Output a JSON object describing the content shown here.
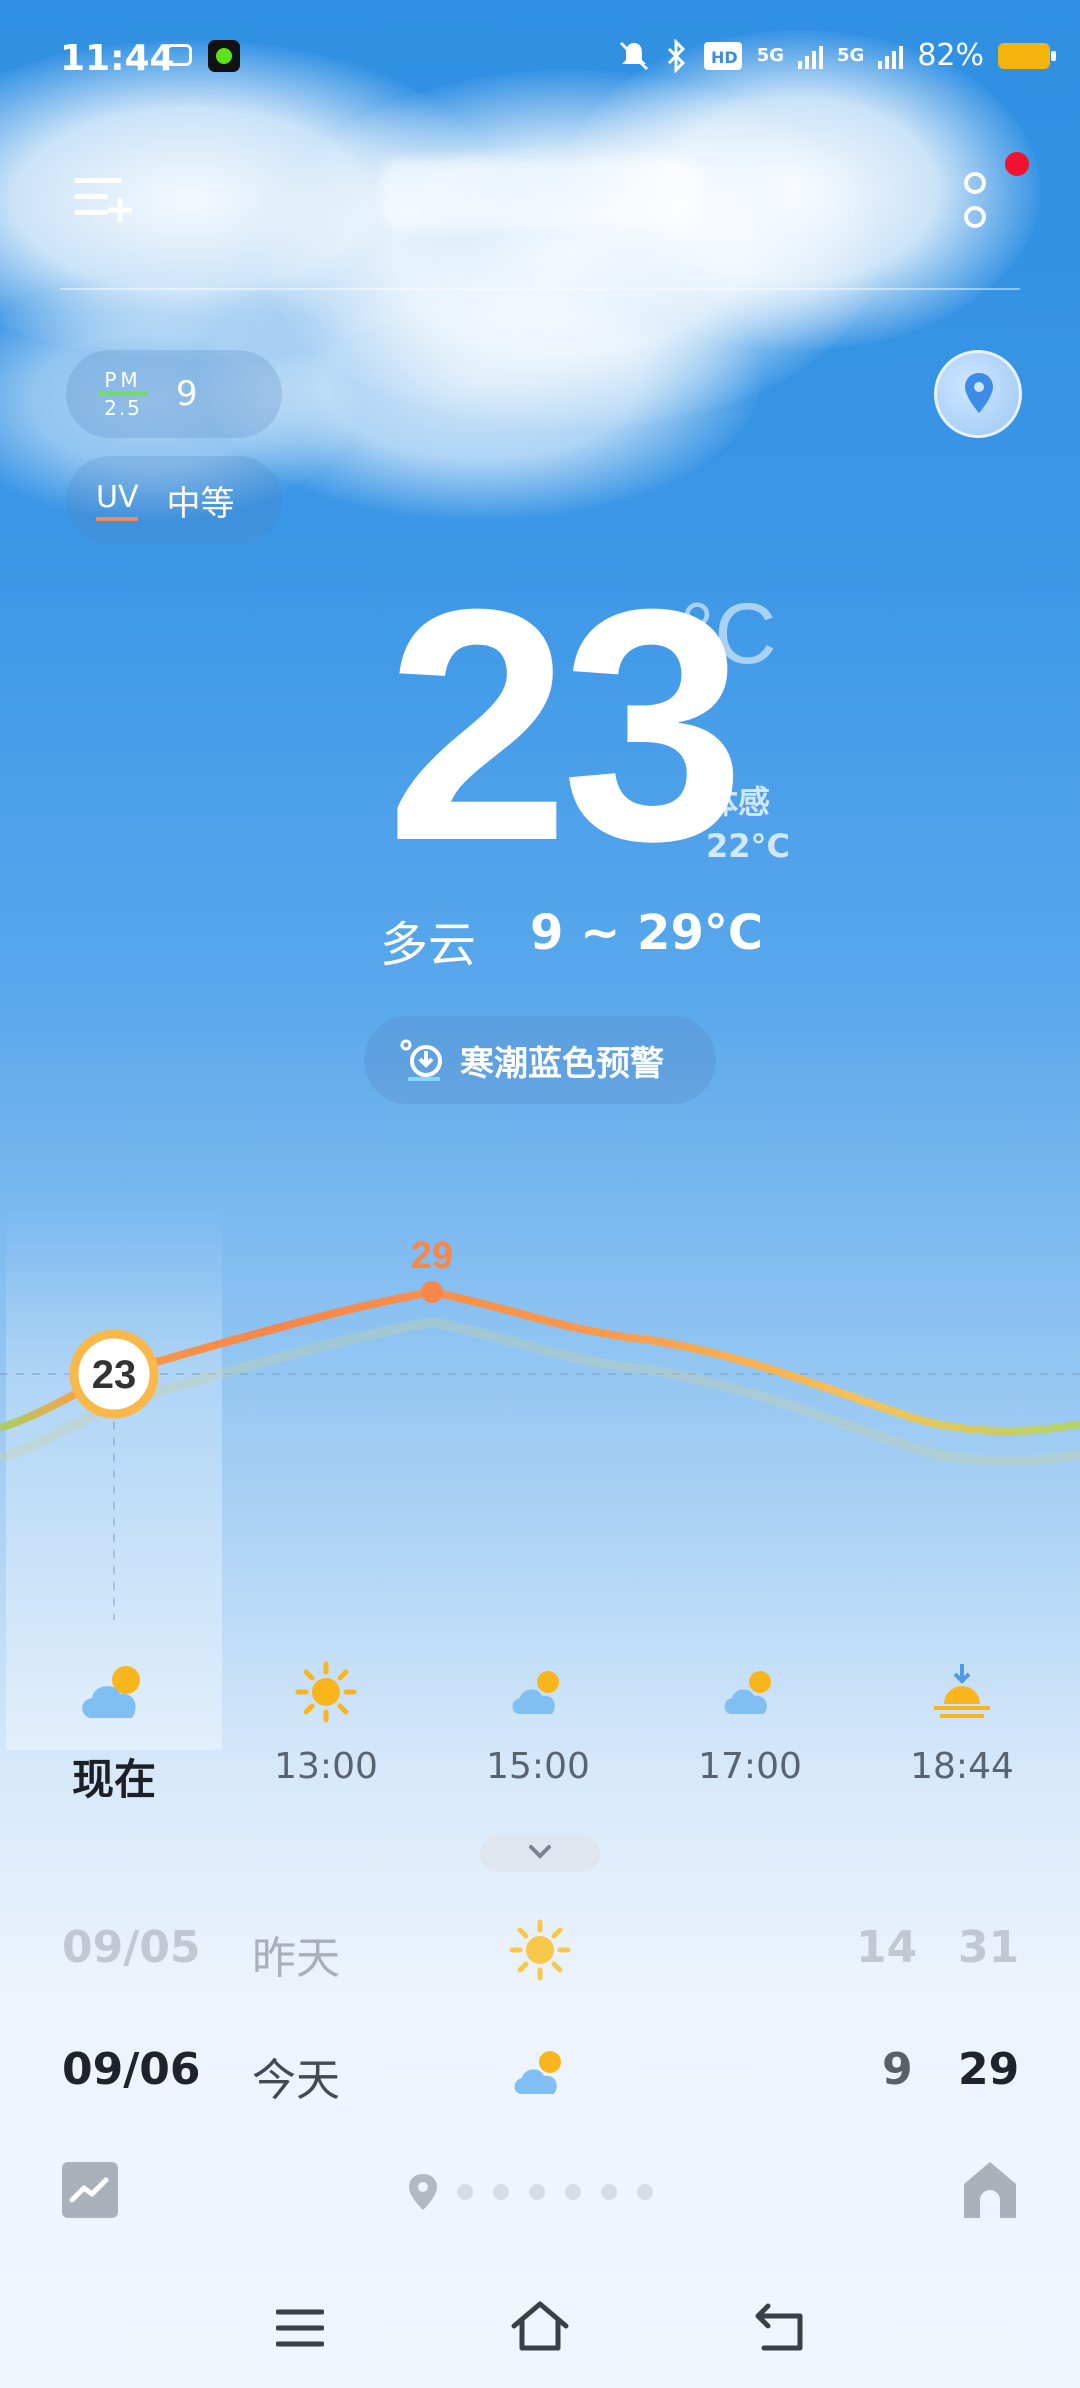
{
  "status_bar": {
    "time": "11:44",
    "network_5g_1": "5G",
    "network_5g_2": "5G",
    "battery": "82%"
  },
  "air": {
    "pm_label_top": "PM",
    "pm_label_bottom": "2.5",
    "pm_value": "9",
    "uv_label": "UV",
    "uv_value": "中等"
  },
  "current": {
    "temperature": "23",
    "unit": "°C",
    "feels_label": "体感",
    "feels_value": "22°C",
    "condition": "多云",
    "range": "9 ~ 29°C"
  },
  "alert": {
    "text": "寒潮蓝色预警"
  },
  "hourly": {
    "current_value": "23",
    "peak_value": "29",
    "items": [
      {
        "label": "现在",
        "icon": "cloudy-icon"
      },
      {
        "label": "13:00",
        "icon": "sunny-icon"
      },
      {
        "label": "15:00",
        "icon": "cloudy-icon"
      },
      {
        "label": "17:00",
        "icon": "cloudy-icon"
      },
      {
        "label": "18:44",
        "icon": "sunset-icon"
      }
    ]
  },
  "daily": [
    {
      "date": "09/05",
      "day": "昨天",
      "icon": "sunny-icon",
      "low": "14",
      "high": "31"
    },
    {
      "date": "09/06",
      "day": "今天",
      "icon": "cloudy-icon",
      "low": "9",
      "high": "29"
    }
  ],
  "colors": {
    "warm": "#f6864a",
    "cool": "#a7cf6a",
    "sun": "#f8b51c",
    "cloud": "#7fbff2"
  }
}
